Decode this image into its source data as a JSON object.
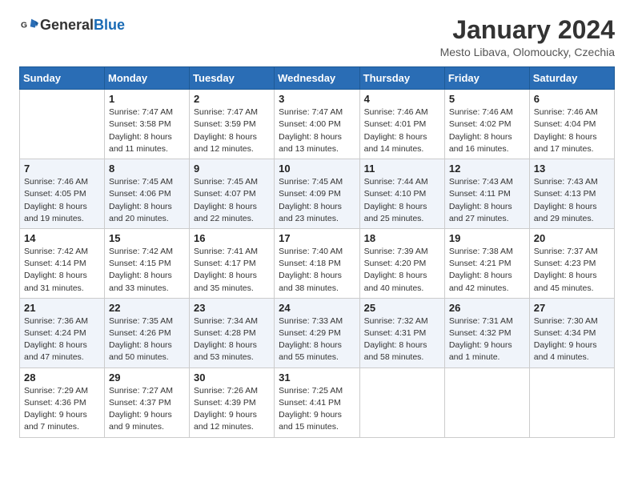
{
  "header": {
    "logo_general": "General",
    "logo_blue": "Blue",
    "title": "January 2024",
    "subtitle": "Mesto Libava, Olomoucky, Czechia"
  },
  "columns": [
    "Sunday",
    "Monday",
    "Tuesday",
    "Wednesday",
    "Thursday",
    "Friday",
    "Saturday"
  ],
  "weeks": [
    [
      {
        "day": "",
        "info": ""
      },
      {
        "day": "1",
        "info": "Sunrise: 7:47 AM\nSunset: 3:58 PM\nDaylight: 8 hours\nand 11 minutes."
      },
      {
        "day": "2",
        "info": "Sunrise: 7:47 AM\nSunset: 3:59 PM\nDaylight: 8 hours\nand 12 minutes."
      },
      {
        "day": "3",
        "info": "Sunrise: 7:47 AM\nSunset: 4:00 PM\nDaylight: 8 hours\nand 13 minutes."
      },
      {
        "day": "4",
        "info": "Sunrise: 7:46 AM\nSunset: 4:01 PM\nDaylight: 8 hours\nand 14 minutes."
      },
      {
        "day": "5",
        "info": "Sunrise: 7:46 AM\nSunset: 4:02 PM\nDaylight: 8 hours\nand 16 minutes."
      },
      {
        "day": "6",
        "info": "Sunrise: 7:46 AM\nSunset: 4:04 PM\nDaylight: 8 hours\nand 17 minutes."
      }
    ],
    [
      {
        "day": "7",
        "info": "Sunrise: 7:46 AM\nSunset: 4:05 PM\nDaylight: 8 hours\nand 19 minutes."
      },
      {
        "day": "8",
        "info": "Sunrise: 7:45 AM\nSunset: 4:06 PM\nDaylight: 8 hours\nand 20 minutes."
      },
      {
        "day": "9",
        "info": "Sunrise: 7:45 AM\nSunset: 4:07 PM\nDaylight: 8 hours\nand 22 minutes."
      },
      {
        "day": "10",
        "info": "Sunrise: 7:45 AM\nSunset: 4:09 PM\nDaylight: 8 hours\nand 23 minutes."
      },
      {
        "day": "11",
        "info": "Sunrise: 7:44 AM\nSunset: 4:10 PM\nDaylight: 8 hours\nand 25 minutes."
      },
      {
        "day": "12",
        "info": "Sunrise: 7:43 AM\nSunset: 4:11 PM\nDaylight: 8 hours\nand 27 minutes."
      },
      {
        "day": "13",
        "info": "Sunrise: 7:43 AM\nSunset: 4:13 PM\nDaylight: 8 hours\nand 29 minutes."
      }
    ],
    [
      {
        "day": "14",
        "info": "Sunrise: 7:42 AM\nSunset: 4:14 PM\nDaylight: 8 hours\nand 31 minutes."
      },
      {
        "day": "15",
        "info": "Sunrise: 7:42 AM\nSunset: 4:15 PM\nDaylight: 8 hours\nand 33 minutes."
      },
      {
        "day": "16",
        "info": "Sunrise: 7:41 AM\nSunset: 4:17 PM\nDaylight: 8 hours\nand 35 minutes."
      },
      {
        "day": "17",
        "info": "Sunrise: 7:40 AM\nSunset: 4:18 PM\nDaylight: 8 hours\nand 38 minutes."
      },
      {
        "day": "18",
        "info": "Sunrise: 7:39 AM\nSunset: 4:20 PM\nDaylight: 8 hours\nand 40 minutes."
      },
      {
        "day": "19",
        "info": "Sunrise: 7:38 AM\nSunset: 4:21 PM\nDaylight: 8 hours\nand 42 minutes."
      },
      {
        "day": "20",
        "info": "Sunrise: 7:37 AM\nSunset: 4:23 PM\nDaylight: 8 hours\nand 45 minutes."
      }
    ],
    [
      {
        "day": "21",
        "info": "Sunrise: 7:36 AM\nSunset: 4:24 PM\nDaylight: 8 hours\nand 47 minutes."
      },
      {
        "day": "22",
        "info": "Sunrise: 7:35 AM\nSunset: 4:26 PM\nDaylight: 8 hours\nand 50 minutes."
      },
      {
        "day": "23",
        "info": "Sunrise: 7:34 AM\nSunset: 4:28 PM\nDaylight: 8 hours\nand 53 minutes."
      },
      {
        "day": "24",
        "info": "Sunrise: 7:33 AM\nSunset: 4:29 PM\nDaylight: 8 hours\nand 55 minutes."
      },
      {
        "day": "25",
        "info": "Sunrise: 7:32 AM\nSunset: 4:31 PM\nDaylight: 8 hours\nand 58 minutes."
      },
      {
        "day": "26",
        "info": "Sunrise: 7:31 AM\nSunset: 4:32 PM\nDaylight: 9 hours\nand 1 minute."
      },
      {
        "day": "27",
        "info": "Sunrise: 7:30 AM\nSunset: 4:34 PM\nDaylight: 9 hours\nand 4 minutes."
      }
    ],
    [
      {
        "day": "28",
        "info": "Sunrise: 7:29 AM\nSunset: 4:36 PM\nDaylight: 9 hours\nand 7 minutes."
      },
      {
        "day": "29",
        "info": "Sunrise: 7:27 AM\nSunset: 4:37 PM\nDaylight: 9 hours\nand 9 minutes."
      },
      {
        "day": "30",
        "info": "Sunrise: 7:26 AM\nSunset: 4:39 PM\nDaylight: 9 hours\nand 12 minutes."
      },
      {
        "day": "31",
        "info": "Sunrise: 7:25 AM\nSunset: 4:41 PM\nDaylight: 9 hours\nand 15 minutes."
      },
      {
        "day": "",
        "info": ""
      },
      {
        "day": "",
        "info": ""
      },
      {
        "day": "",
        "info": ""
      }
    ]
  ]
}
